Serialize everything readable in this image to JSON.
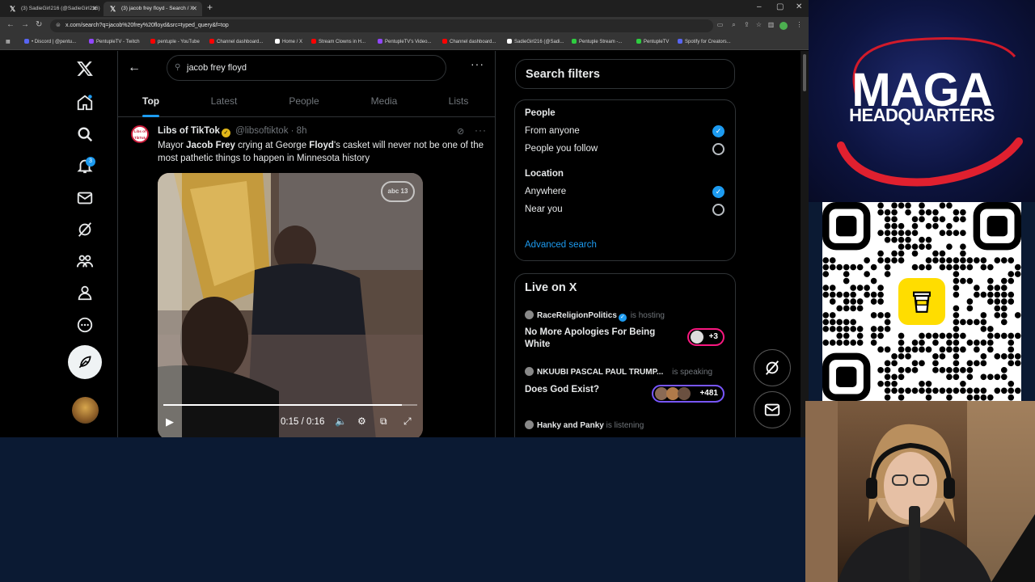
{
  "browser": {
    "tabs": [
      {
        "label": "(3) SadieGirl216 (@SadieGirl216)",
        "active": false
      },
      {
        "label": "(3) jacob frey floyd - Search / X",
        "active": true
      }
    ],
    "url": "x.com/search?q=jacob%20frey%20floyd&src=typed_query&f=top",
    "bookmarks": [
      {
        "label": "• Discord | @pentu...",
        "color": "#5865f2"
      },
      {
        "label": "PentupleTV - Twitch",
        "color": "#9146ff"
      },
      {
        "label": "pentuple - YouTube",
        "color": "#ff0000"
      },
      {
        "label": "Channel dashboard...",
        "color": "#ff0000"
      },
      {
        "label": "Home / X",
        "color": "#ffffff"
      },
      {
        "label": "Stream Clowns in H...",
        "color": "#ff0000"
      },
      {
        "label": "PentupleTV's Video...",
        "color": "#9146ff"
      },
      {
        "label": "Channel dashboard...",
        "color": "#ff0000"
      },
      {
        "label": "SadieGirl216 (@Sadi...",
        "color": "#ffffff"
      },
      {
        "label": "Pentuple Stream -...",
        "color": "#2ecc40"
      },
      {
        "label": "PentupleTV",
        "color": "#2ecc40"
      },
      {
        "label": "Spotify for Creators...",
        "color": "#5865f2"
      }
    ]
  },
  "nav": {
    "notification_count": "3"
  },
  "search": {
    "query": "jacob frey floyd",
    "tabs": [
      "Top",
      "Latest",
      "People",
      "Media",
      "Lists"
    ],
    "active_tab": "Top"
  },
  "tweet": {
    "author_name": "Libs of TikTok",
    "handle_time": "@libsoftiktok · 8h",
    "avatar_text": "Libs of TikTok",
    "text_parts": [
      "Mayor ",
      "Jacob Frey",
      " crying at George ",
      "Floyd",
      "'s casket will never not be one of the most pathetic things to happen in Minnesota history"
    ],
    "video": {
      "badge": "abc 13",
      "time": "0:15 / 0:16",
      "progress": 0.94
    }
  },
  "filters": {
    "title": "Search filters",
    "people_heading": "People",
    "people_options": [
      {
        "label": "From anyone",
        "selected": true
      },
      {
        "label": "People you follow",
        "selected": false
      }
    ],
    "location_heading": "Location",
    "location_options": [
      {
        "label": "Anywhere",
        "selected": true
      },
      {
        "label": "Near you",
        "selected": false
      }
    ],
    "advanced": "Advanced search"
  },
  "live": {
    "title": "Live on X",
    "spaces": [
      {
        "host": "RaceReligionPolitics",
        "verified": true,
        "status": "is hosting",
        "topic": "No More Apologies For Being White",
        "count": "+3",
        "pill_color": "#f91880"
      },
      {
        "host": "NKUUBI PASCAL PAUL TRUMP...",
        "verified": false,
        "status": "is speaking",
        "topic": "Does God Exist?",
        "count": "+481",
        "pill_color": "#7856ff"
      },
      {
        "host": "Hanky and Panky",
        "verified": false,
        "status": "is listening",
        "topic": "",
        "count": "",
        "pill_color": ""
      }
    ]
  },
  "overlay": {
    "title": "MAGA",
    "subtitle": "HEADQUARTERS"
  }
}
